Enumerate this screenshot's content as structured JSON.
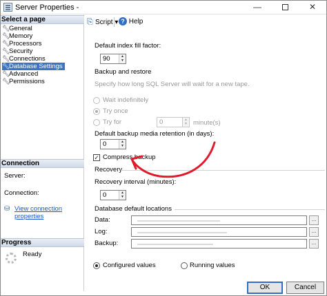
{
  "window": {
    "title": "Server Properties -",
    "min_symbol": "—",
    "close_symbol": "✕"
  },
  "left": {
    "select_page_header": "Select a page",
    "nav_items": [
      {
        "label": "General",
        "selected": false
      },
      {
        "label": "Memory",
        "selected": false
      },
      {
        "label": "Processors",
        "selected": false
      },
      {
        "label": "Security",
        "selected": false
      },
      {
        "label": "Connections",
        "selected": false
      },
      {
        "label": "Database Settings",
        "selected": true
      },
      {
        "label": "Advanced",
        "selected": false
      },
      {
        "label": "Permissions",
        "selected": false
      }
    ],
    "connection_header": "Connection",
    "server_label": "Server:",
    "connection_label": "Connection:",
    "view_connection_link": "View connection properties",
    "progress_header": "Progress",
    "progress_status": "Ready"
  },
  "toolbar": {
    "script_label": "Script",
    "script_dropdown": "▾",
    "help_label": "Help",
    "help_glyph": "?"
  },
  "settings": {
    "fill_factor_label": "Default index fill factor:",
    "fill_factor_value": "90",
    "backup_restore_title": "Backup and restore",
    "tape_prompt": "Specify how long SQL Server will wait for a new tape.",
    "wait_indefinitely": "Wait indefinitely",
    "try_once": "Try once",
    "try_for": "Try for",
    "try_for_value": "0",
    "minutes_suffix": "minute(s)",
    "retention_label": "Default backup media retention (in days):",
    "retention_value": "0",
    "compress_backup_label": "Compress backup",
    "compress_backup_checked": true,
    "recovery_title": "Recovery",
    "recovery_interval_label": "Recovery interval (minutes):",
    "recovery_interval_value": "0",
    "db_locations_title": "Database default locations",
    "data_label": "Data:",
    "log_label": "Log:",
    "backup_label": "Backup:",
    "browse_glyph": "...",
    "configured_values": "Configured values",
    "running_values": "Running values"
  },
  "footer": {
    "ok_label": "OK",
    "cancel_label": "Cancel"
  },
  "colors": {
    "annotation_arrow": "#e0192b",
    "selection": "#3a75c4",
    "link": "#1a56c8"
  }
}
